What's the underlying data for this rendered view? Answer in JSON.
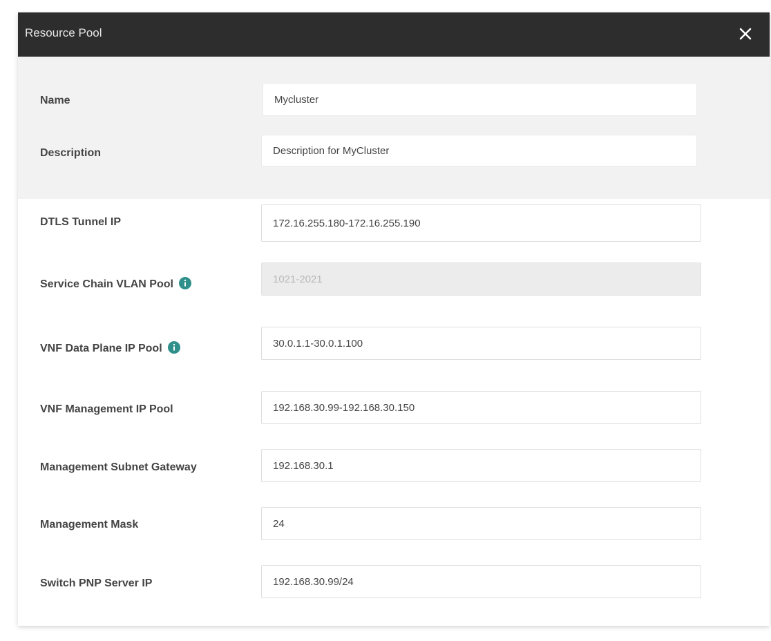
{
  "dialog": {
    "title": "Resource Pool",
    "close_icon": "close-icon"
  },
  "colors": {
    "titlebar": "#2d2d2d",
    "info_icon": "#2f8f8a",
    "top_section": "#f2f2f2"
  },
  "fields": {
    "name": {
      "label": "Name",
      "value": "Mycluster"
    },
    "description": {
      "label": "Description",
      "value": "Description for MyCluster"
    },
    "dtls_tunnel_ip": {
      "label": "DTLS Tunnel IP",
      "value": "172.16.255.180-172.16.255.190"
    },
    "service_chain_vlan_pool": {
      "label": "Service Chain VLAN Pool",
      "value": "1021-2021",
      "disabled": true,
      "icon": "info-icon"
    },
    "vnf_data_plane_ip_pool": {
      "label": "VNF Data Plane IP Pool",
      "value": "30.0.1.1-30.0.1.100",
      "icon": "info-icon"
    },
    "vnf_management_ip_pool": {
      "label": "VNF Management IP Pool",
      "value": "192.168.30.99-192.168.30.150"
    },
    "management_subnet_gateway": {
      "label": "Management Subnet Gateway",
      "value": "192.168.30.1"
    },
    "management_mask": {
      "label": "Management Mask",
      "value": "24"
    },
    "switch_pnp_server_ip": {
      "label": "Switch PNP Server IP",
      "value": "192.168.30.99/24"
    }
  }
}
